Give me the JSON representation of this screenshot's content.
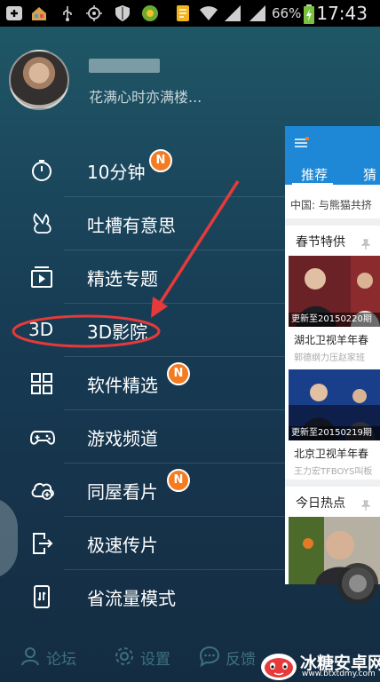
{
  "status_bar": {
    "battery": "66%",
    "time": "17:43",
    "icons": [
      "add-icon",
      "home-icon",
      "usb-icon",
      "gps-icon",
      "shield-icon",
      "game-icon",
      "doc-icon",
      "wifi-icon",
      "signal-icon",
      "signal-icon",
      "battery-icon"
    ]
  },
  "profile": {
    "signature": "花满心时亦满楼..."
  },
  "menu": {
    "items": [
      {
        "label": "10分钟",
        "icon": "stopwatch-icon",
        "badge": "N"
      },
      {
        "label": "吐槽有意思",
        "icon": "rabbit-icon"
      },
      {
        "label": "精选专题",
        "icon": "playlist-icon"
      },
      {
        "label": "3D影院",
        "icon": "3d-icon",
        "icon_text": "3D"
      },
      {
        "label": "软件精选",
        "icon": "grid-icon",
        "badge": "N"
      },
      {
        "label": "游戏频道",
        "icon": "gamepad-icon"
      },
      {
        "label": "同屋看片",
        "icon": "cloud-share-icon",
        "badge": "N"
      },
      {
        "label": "极速传片",
        "icon": "phone-export-icon"
      },
      {
        "label": "省流量模式",
        "icon": "phone-data-icon"
      }
    ]
  },
  "bottom_bar": {
    "forum": "论坛",
    "settings": "设置",
    "feedback": "反馈"
  },
  "preview_panel": {
    "tab_recommend": "推荐",
    "tab_guess": "猜",
    "news": "中国: 与熊猫共挤",
    "section1": "春节特供",
    "video1_caption": "更新至20150220期",
    "video1_title": "湖北卫视羊年春",
    "video1_sub": "郭德纲力压赵家班",
    "video2_caption": "更新至20150219期",
    "video2_title": "北京卫视羊年春",
    "video2_sub": "王力宏TFBOYS叫板",
    "section2": "今日热点"
  },
  "watermark": {
    "name": "冰糖安卓网",
    "url": "www.btxtdmy.com"
  },
  "colors": {
    "accent": "#1e88d6",
    "badge": "#f47b20",
    "annotation": "#e43a3a"
  }
}
